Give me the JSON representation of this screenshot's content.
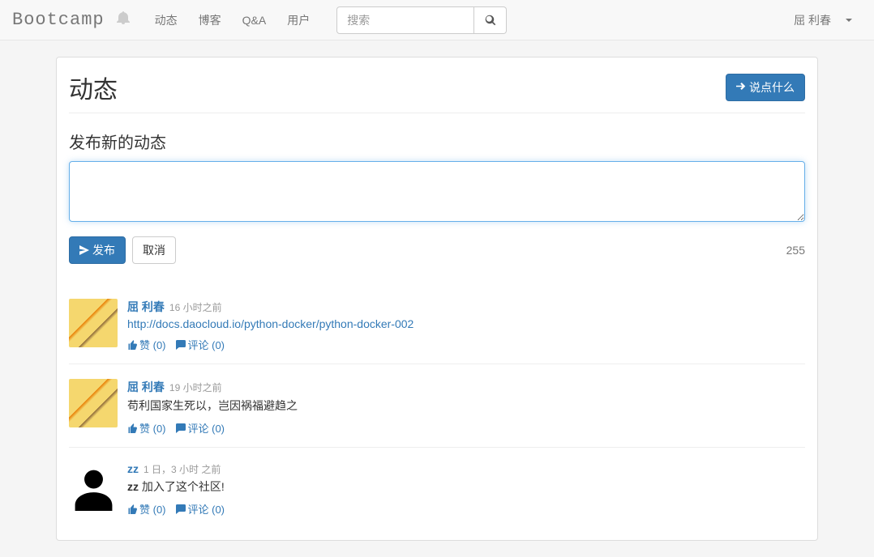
{
  "navbar": {
    "brand": "Bootcamp",
    "links": [
      "动态",
      "博客",
      "Q&A",
      "用户"
    ],
    "search_placeholder": "搜索",
    "user_name": "屈 利春"
  },
  "page": {
    "title": "动态",
    "say_something_label": "说点什么"
  },
  "compose": {
    "label": "发布新的动态",
    "publish_label": "发布",
    "cancel_label": "取消",
    "char_count": "255"
  },
  "feed": [
    {
      "author": "屈 利春",
      "time": "16 小时之前",
      "content_type": "link",
      "content": "http://docs.daocloud.io/python-docker/python-docker-002",
      "avatar": "pikachu",
      "like_label": "赞",
      "like_count": 0,
      "comment_label": "评论",
      "comment_count": 0
    },
    {
      "author": "屈 利春",
      "time": "19 小时之前",
      "content_type": "text",
      "content": "苟利国家生死以，岂因祸福避趋之",
      "avatar": "pikachu",
      "like_label": "赞",
      "like_count": 0,
      "comment_label": "评论",
      "comment_count": 0
    },
    {
      "author": "zz",
      "time": "1 日，3 小时 之前",
      "content_type": "joined",
      "content_prefix": "zz",
      "content": " 加入了这个社区!",
      "avatar": "default",
      "like_label": "赞",
      "like_count": 0,
      "comment_label": "评论",
      "comment_count": 0
    }
  ]
}
